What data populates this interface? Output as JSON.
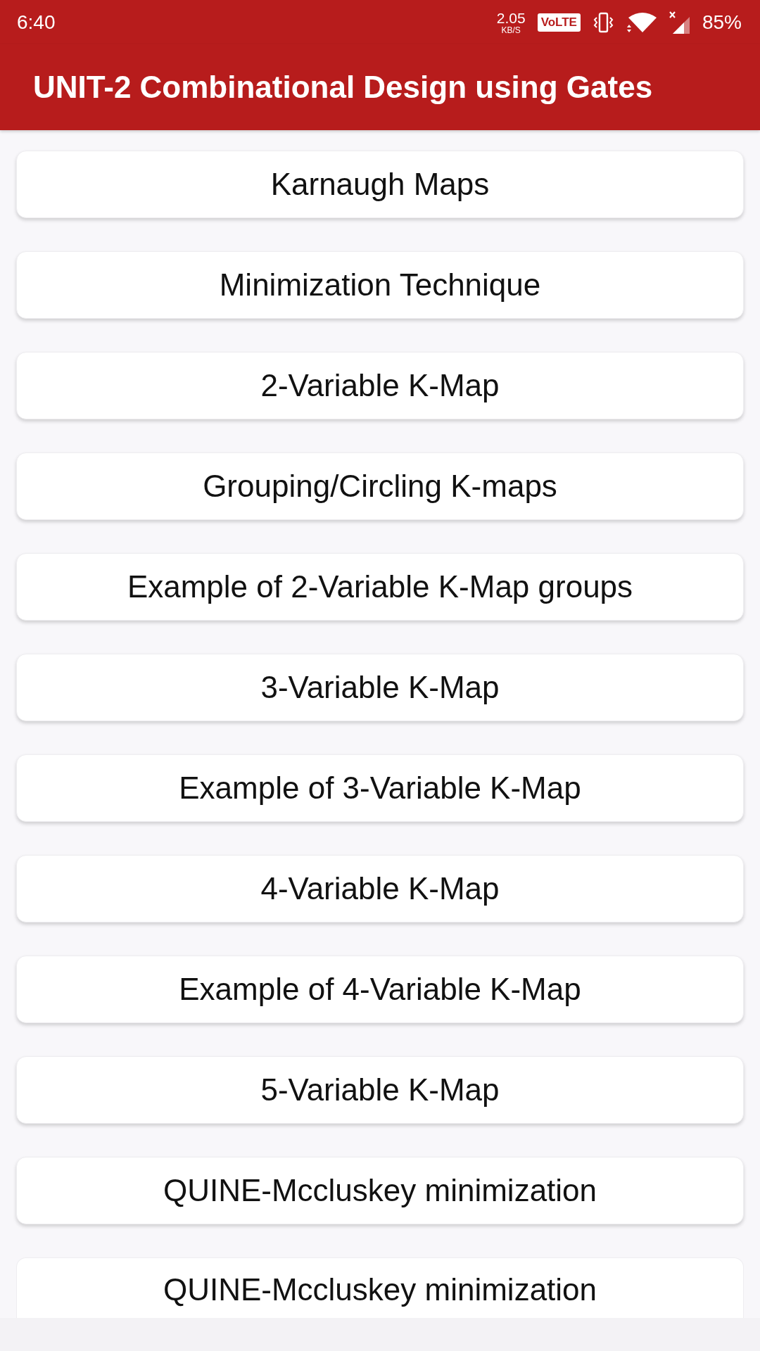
{
  "status_bar": {
    "time": "6:40",
    "data_rate": {
      "value": "2.05",
      "unit": "KB/S"
    },
    "volte_badge": "VoLTE",
    "battery": "85%"
  },
  "app_bar": {
    "title": "UNIT-2 Combinational Design using Gates"
  },
  "topics": [
    "Karnaugh Maps",
    "Minimization Technique",
    "2-Variable K-Map",
    "Grouping/Circling K-maps",
    "Example of 2-Variable K-Map groups",
    "3-Variable K-Map",
    "Example of 3-Variable K-Map",
    "4-Variable K-Map",
    "Example of 4-Variable K-Map",
    "5-Variable K-Map",
    "QUINE-Mccluskey minimization",
    "QUINE-Mccluskey minimization"
  ]
}
